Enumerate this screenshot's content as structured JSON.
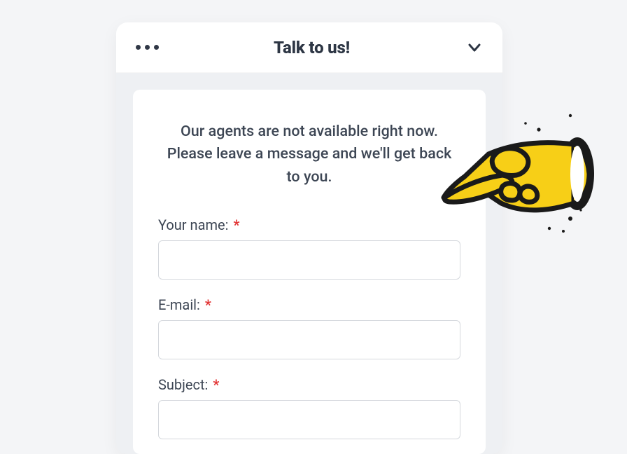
{
  "header": {
    "title": "Talk to us!"
  },
  "intro": "Our agents are not available right now. Please leave a message and we'll get back to you.",
  "form": {
    "name": {
      "label": "Your name:",
      "required_mark": "*",
      "value": ""
    },
    "email": {
      "label": "E-mail:",
      "required_mark": "*",
      "value": ""
    },
    "subject": {
      "label": "Subject:",
      "required_mark": "*",
      "value": ""
    }
  },
  "colors": {
    "page_bg": "#f4f5f7",
    "widget_card_bg": "#ffffff",
    "widget_body_bg": "#eef0f3",
    "text": "#333b47",
    "required": "#e23434",
    "hand_fill": "#f7cf17",
    "hand_stroke": "#1a1a1a"
  }
}
